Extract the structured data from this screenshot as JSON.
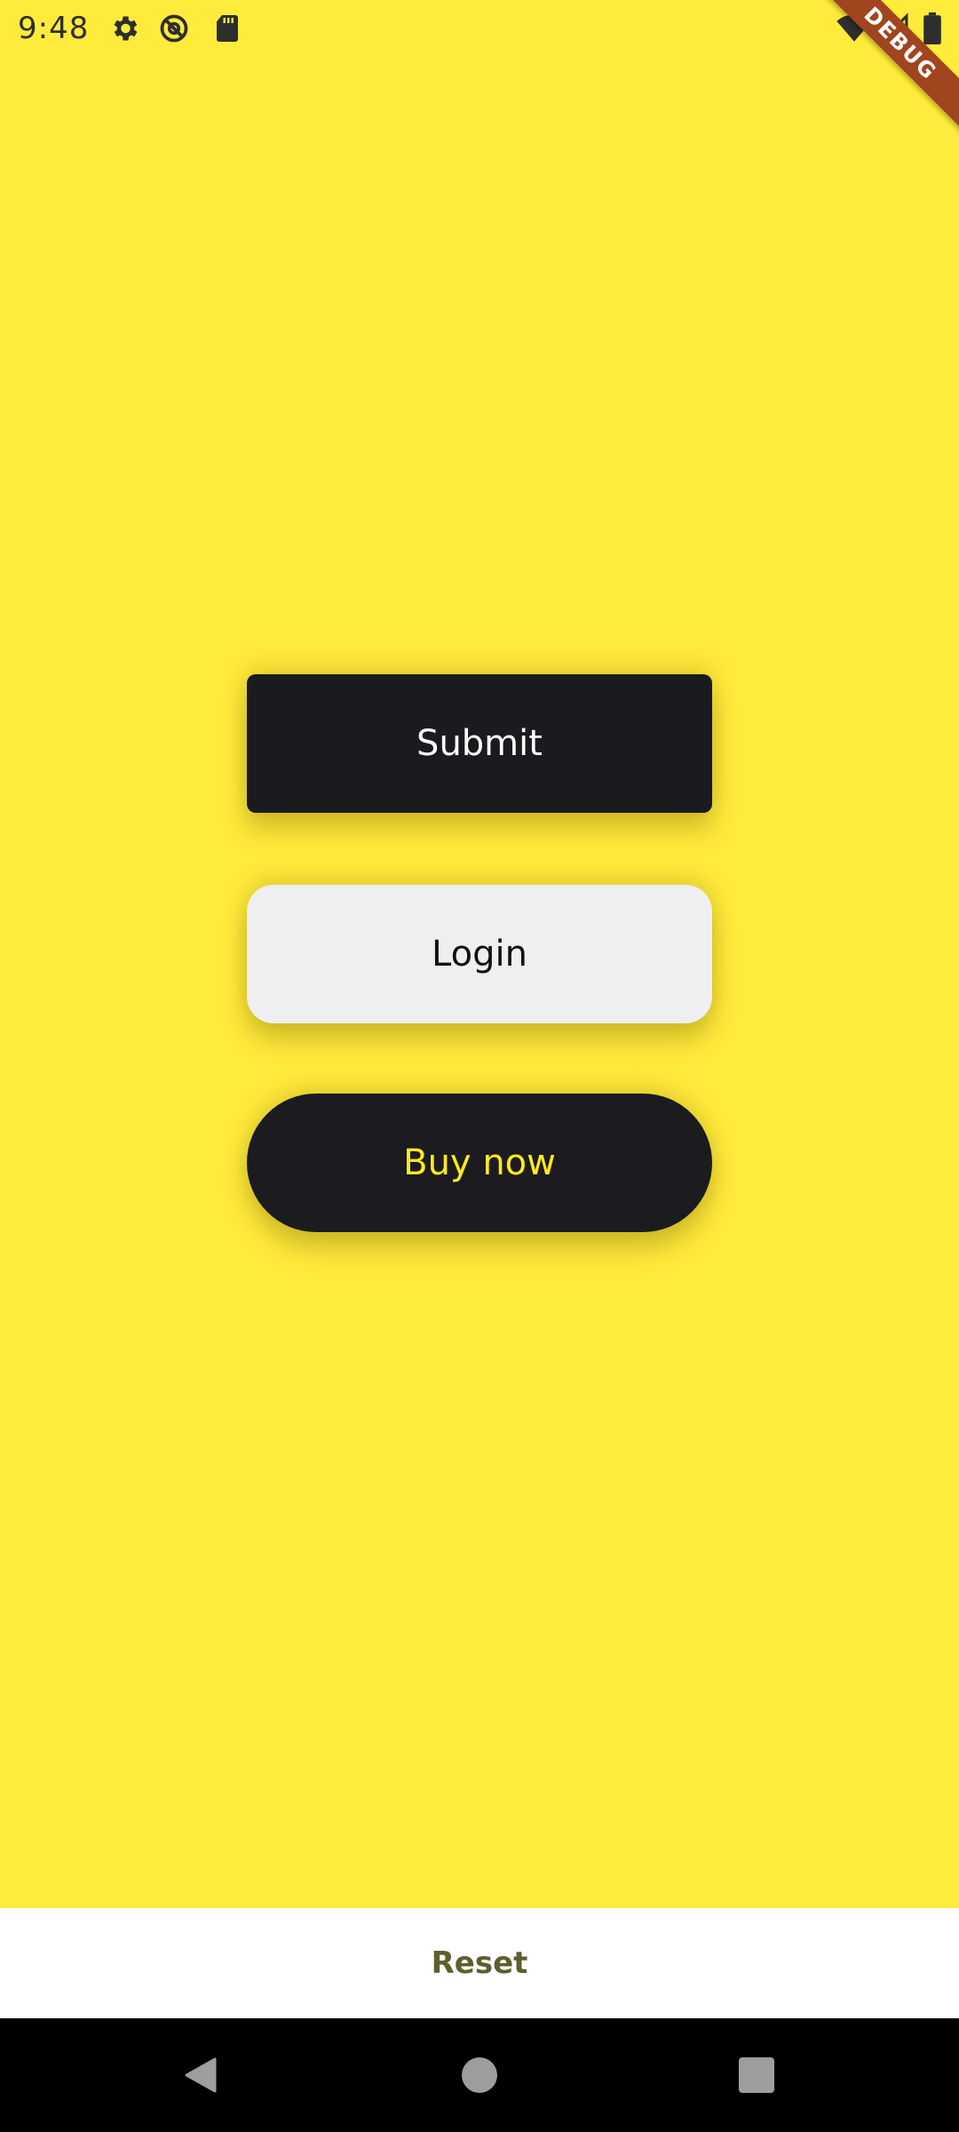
{
  "status_bar": {
    "time": "9:48",
    "left_icons": [
      "gear-icon",
      "do-not-disturb-icon",
      "sd-card-icon"
    ],
    "right_icons": [
      "wifi-icon",
      "signal-icon",
      "battery-icon"
    ]
  },
  "debug_banner": {
    "label": "DEBUG"
  },
  "buttons": {
    "submit": "Submit",
    "login": "Login",
    "buy_now": "Buy now"
  },
  "bottom_bar": {
    "reset": "Reset"
  },
  "navigation": {
    "items": [
      "back-icon",
      "home-icon",
      "recents-icon"
    ]
  },
  "colors": {
    "background": "#ffeb3b",
    "dark_button": "#1b1b1f",
    "light_button": "#efeef1",
    "buy_text": "#ffeb1a",
    "reset_text": "#5d5f2f"
  }
}
